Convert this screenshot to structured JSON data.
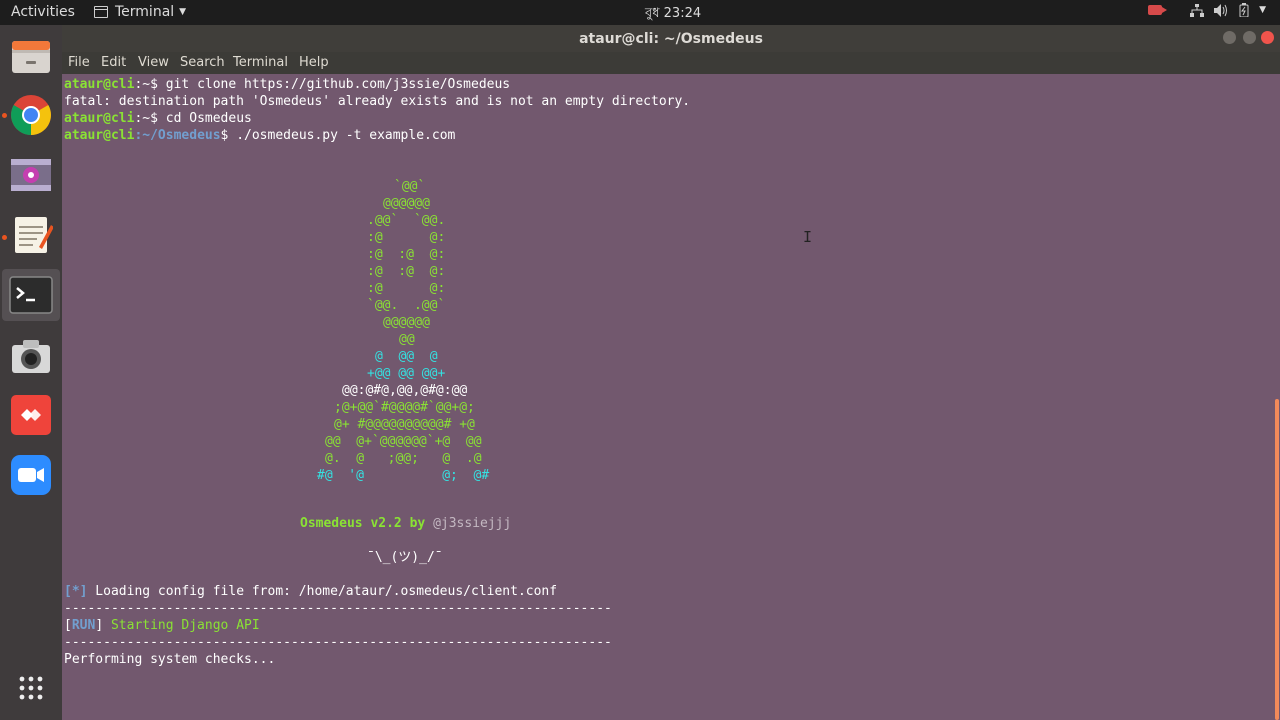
{
  "topbar": {
    "activities": "Activities",
    "app_name": "Terminal",
    "clock": "বুধ 23:24"
  },
  "dock": {
    "items": [
      "files-icon",
      "chrome-icon",
      "video-icon",
      "text-editor-icon",
      "terminal-icon",
      "camera-icon",
      "anydesk-icon",
      "zoom-icon",
      "show-apps-icon"
    ]
  },
  "window": {
    "title": "ataur@cli: ~/Osmedeus",
    "menu": [
      "File",
      "Edit",
      "View",
      "Search",
      "Terminal",
      "Help"
    ]
  },
  "terminal": {
    "prompt1_user": "ataur@cli",
    "prompt1_path": ":~$",
    "cmd1": " git clone https://github.com/j3ssie/Osmedeus",
    "err1": "fatal: destination path 'Osmedeus' already exists and is not an empty directory.",
    "prompt2_user": "ataur@cli",
    "prompt2_path": ":~$",
    "cmd2": " cd Osmedeus",
    "prompt3_user": "ataur@cli",
    "prompt3_path": ":~/Osmedeus",
    "prompt3_dollar": "$",
    "cmd3": " ./osmedeus.py -t example.com",
    "art": {
      "l1": "`@@`",
      "l2": "@@@@@@",
      "l3": ".@@`  `@@.",
      "l4": ":@      @:",
      "l5": ":@  :@  @:",
      "l6": ":@  :@  @:",
      "l7": ":@      @:",
      "l8": "`@@.  .@@`",
      "l9": "@@@@@@",
      "l10": "@@",
      "l11": "@  @@  @",
      "l12": "+@@ @@ @@+",
      "l13": "@@:@#@,@@,@#@:@@",
      "l14": ";@+@@`#@@@@#`@@+@;",
      "l15": "@+ #@@@@@@@@@@# +@",
      "l16": "@@  @+`@@@@@@`+@  @@",
      "l17": "@.  @   ;@@;   @  .@",
      "l18": "#@  '@          @;  @#"
    },
    "banner_name": "Osmedeus v2.2 by ",
    "banner_author": "@j3ssiejjj",
    "shrug": "¯\\_(ツ)_/¯",
    "loading_tag": "[*]",
    "loading_text": " Loading config file from: /home/ataur/.osmedeus/client.conf",
    "separator": "----------------------------------------------------------------------",
    "run_tag_open": "[",
    "run_tag": "RUN",
    "run_tag_close": "]",
    "run_text": " Starting Django API",
    "checks": "Performing system checks..."
  }
}
